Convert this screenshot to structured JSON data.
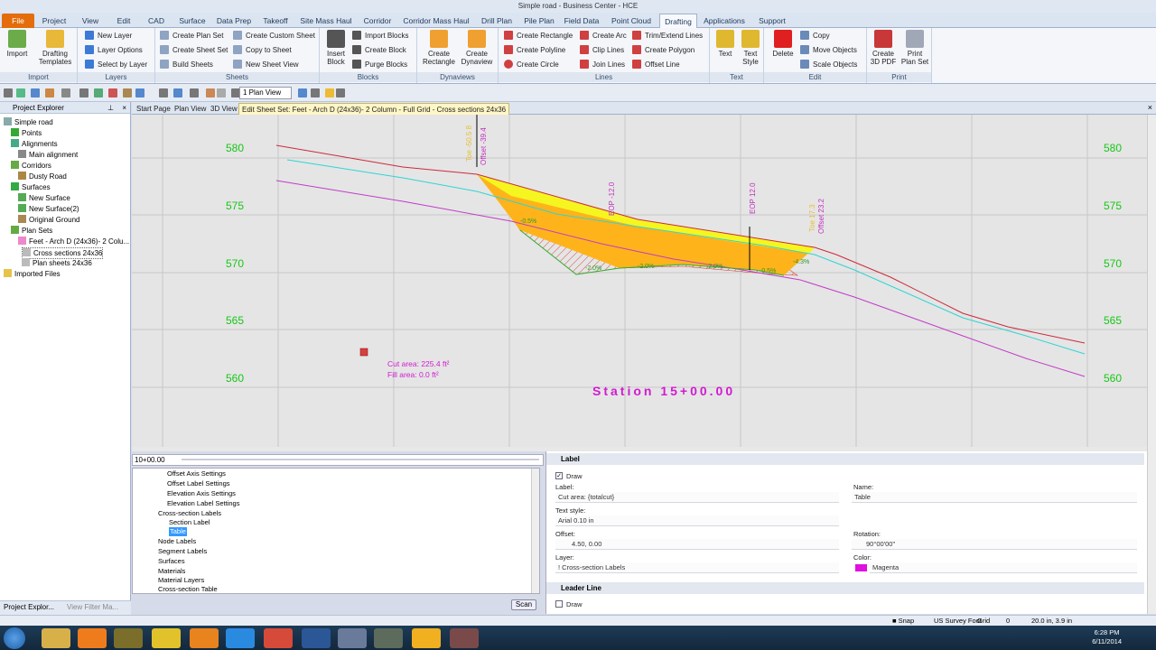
{
  "window": {
    "title": "Simple road - Business Center - HCE"
  },
  "ribbon_tabs": [
    "File",
    "Project",
    "View",
    "Edit",
    "CAD",
    "Surface",
    "Data Prep",
    "Takeoff",
    "Site Mass Haul",
    "Corridor",
    "Corridor Mass Haul",
    "Drill Plan",
    "Pile Plan",
    "Field Data",
    "Point Cloud",
    "Drafting",
    "Applications",
    "Support"
  ],
  "groups": {
    "import": {
      "label": "Import",
      "buttons": [
        "Import",
        "Drafting Templates"
      ]
    },
    "layers": {
      "label": "Layers",
      "buttons": [
        "New Layer",
        "Layer Options",
        "Select by Layer"
      ]
    },
    "sheets": {
      "label": "Sheets",
      "buttons": [
        "Create Plan Set",
        "Create Sheet Set",
        "Build Sheets",
        "Create Custom Sheet",
        "Copy to Sheet",
        "New Sheet View"
      ]
    },
    "blocks": {
      "label": "Blocks",
      "buttons": [
        "Insert Block",
        "Import Blocks",
        "Create Block",
        "Purge Blocks"
      ]
    },
    "dynaviews": {
      "label": "Dynaviews",
      "buttons": [
        "Create Rectangle",
        "Create Dynaview"
      ]
    },
    "lines": {
      "label": "Lines",
      "buttons": [
        "Create Rectangle",
        "Create Polyline",
        "Create Circle",
        "Create Arc",
        "Clip Lines",
        "Join Lines",
        "Trim/Extend Lines",
        "Create Polygon",
        "Offset Line"
      ]
    },
    "text": {
      "label": "Text",
      "buttons": [
        "Text",
        "Text Style"
      ]
    },
    "edit": {
      "label": "Edit",
      "buttons": [
        "Delete",
        "Copy",
        "Move Objects",
        "Scale Objects"
      ]
    },
    "print": {
      "label": "Print",
      "buttons": [
        "Create 3D PDF",
        "Print Plan Set"
      ]
    }
  },
  "toolbar": {
    "view_select": "1 Plan View"
  },
  "explorer": {
    "title": "Project Explorer",
    "items": [
      "Simple road",
      "Points",
      "Alignments",
      "Main alignment",
      "Corridors",
      "Dusty Road",
      "Surfaces",
      "New Surface",
      "New Surface(2)",
      "Original Ground",
      "Plan Sets",
      "Feet - Arch D (24x36)- 2 Colu...",
      "Cross sections 24x36",
      "Plan sheets 24x36",
      "Imported Files"
    ],
    "bottom_tabs": [
      "Project Explor...",
      "View Filter Ma..."
    ]
  },
  "doc_tabs": [
    "Start Page",
    "Plan View",
    "3D View",
    "Edit Sheet Set: Feet - Arch D (24x36)- 2 Column - Full Grid - Cross sections 24x36"
  ],
  "xsection": {
    "elevations": [
      "580",
      "575",
      "570",
      "565",
      "560"
    ],
    "station_label": "Station 15+00.00",
    "cut_area": "Cut area: 225.4 ft²",
    "fill_area": "Fill area:  0.0 ft²",
    "vlabels": [
      "Toe -50.5 8",
      "Offset -39.4",
      "EOP -12.0",
      "EOP 12.0",
      "Toe 17.3",
      "Offset 23.2"
    ],
    "slopes": [
      "-0.5%",
      "-2.0%",
      "-2.0%",
      "-2.0%",
      "-0.5%",
      "-4.3%",
      "-1.0%"
    ],
    "colors": {
      "elev": "#16c716",
      "existing": "#cc2a3c",
      "cyan": "#2fd4d4",
      "magenta": "#c23cc8",
      "fill": "#ffb31a",
      "yellow": "#f5f520",
      "station": "#d21ad2"
    }
  },
  "station_input": "10+00.00",
  "settings_tree": [
    "Offset Axis Settings",
    "Offset Label Settings",
    "Elevation Axis Settings",
    "Elevation Label Settings",
    "Cross-section Labels",
    "Section Label",
    "Table",
    "Node Labels",
    "Segment Labels",
    "Surfaces",
    "Materials",
    "Material Layers",
    "Cross-section Table"
  ],
  "scan_button": "Scan",
  "props": {
    "section_label": "Label",
    "draw_label": "Draw",
    "label_label": "Label:",
    "label_value": "Cut area: {totalcut}",
    "name_label": "Name:",
    "name_value": "Table",
    "textstyle_label": "Text style:",
    "textstyle_value": "Arial 0.10 in",
    "offset_label": "Offset:",
    "offset_value": "4.50, 0.00",
    "rotation_label": "Rotation:",
    "rotation_value": "90°00'00\"",
    "layer_label": "Layer:",
    "layer_value": "! Cross-section Labels",
    "color_label": "Color:",
    "color_value": "Magenta",
    "leader_section": "Leader Line",
    "leader_draw": "Draw"
  },
  "status": {
    "snap": "Snap",
    "units": "US Survey Foot",
    "grid": "Grid",
    "count": "0",
    "size": "20.0 in, 3.9 in"
  },
  "clock": {
    "time": "6:28 PM",
    "date": "6/11/2014"
  }
}
